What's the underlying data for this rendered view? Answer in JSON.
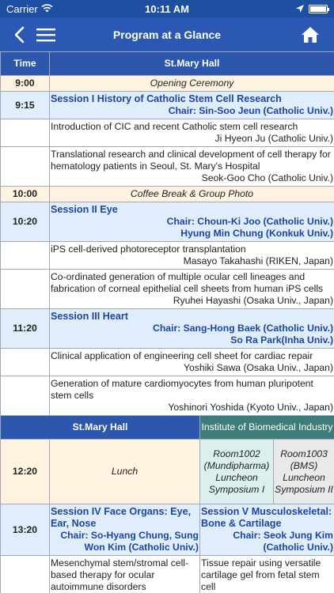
{
  "status": {
    "carrier": "Carrier",
    "time": "10:11 AM"
  },
  "nav": {
    "title": "Program at a Glance"
  },
  "table": {
    "header_time": "Time",
    "header_hall": "St.Mary Hall",
    "rows": [
      {
        "time": "9:00",
        "text": "Opening Ceremony"
      },
      {
        "time": "9:15",
        "session": "Session I History of Catholic Stem Cell Research",
        "chair": "Chair: Sin-Soo Jeun (Catholic Univ.)"
      },
      {
        "talk": "Introduction of CIC and recent Catholic stem cell research",
        "speaker": "Ji Hyeon Ju (Catholic Univ.)"
      },
      {
        "talk": "Translational research and clinical development of cell therapy for hematology patients in Seoul, St. Mary's Hospital",
        "speaker": "Seok-Goo Cho (Catholic Univ.)"
      },
      {
        "time": "10:00",
        "text": "Coffee Break & Group Photo"
      },
      {
        "time": "10:20",
        "session": "Session II Eye",
        "chair1": "Chair: Choun-Ki Joo (Catholic Univ.)",
        "chair2": "Hyung Min Chung (Konkuk Univ.)"
      },
      {
        "talk": "iPS cell-derived photoreceptor transplantation",
        "speaker": "Masayo Takahashi (RIKEN, Japan)"
      },
      {
        "talk": "Co-ordinated generation of multiple ocular cell lineages and fabrication of corneal epithelial cell sheets from human iPS cells",
        "speaker": "Ryuhei Hayashi (Osaka Univ., Japan)"
      },
      {
        "time": "11:20",
        "session": "Session III Heart",
        "chair1": "Chair: Sang-Hong Baek (Catholic Univ.)",
        "chair2": "So Ra Park(Inha Univ.)"
      },
      {
        "talk": "Clinical application of engineering cell sheet for cardiac repair",
        "speaker": "Yoshiki Sawa (Osaka Univ., Japan)"
      },
      {
        "talk": "Generation of mature cardiomyocytes from human pluripotent stem cells",
        "speaker": "Yoshinori Yoshida (Kyoto Univ., Japan)"
      }
    ],
    "split_header": {
      "left": "St.Mary Hall",
      "right": "Institute of Biomedical Industry"
    },
    "lunch": {
      "time": "12:20",
      "text": "Lunch",
      "room1": "Room1002 (Mundipharma) Luncheon Symposium I",
      "room2": "Room1003 (BMS) Luncheon Symposium II"
    },
    "sessions_1320": {
      "time": "13:20",
      "left_title": "Session IV Face Organs: Eye, Ear, Nose",
      "left_chair": "Chair: So-Hyang Chung, Sung Won Kim (Catholic Univ.)",
      "right_title": "Session V Musculoskeletal: Bone & Cartilage",
      "right_chair": "Chair: Seok Jung Kim (Catholic Univ.)"
    },
    "last_row": {
      "left": "Mesenchymal stem/stromal cell-based therapy for ocular autoimmune disorders",
      "right": "Tissue repair using versatile cartilage gel from fetal stem cell"
    }
  }
}
